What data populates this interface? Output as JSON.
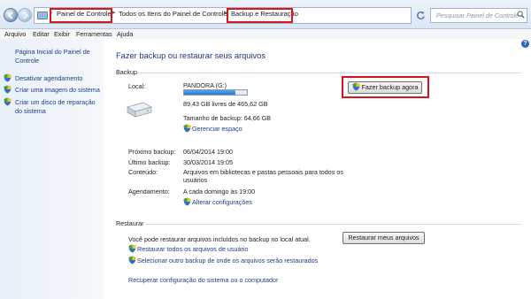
{
  "addressbar": {
    "breadcrumbs": [
      "Painel de Controle",
      "Todos os Itens do Painel de Controle",
      "Backup e Restauração"
    ],
    "search_placeholder": "Pesquisar Painel de Controle"
  },
  "menu": {
    "items": [
      "Arquivo",
      "Editar",
      "Exibir",
      "Ferramentas",
      "Ajuda"
    ]
  },
  "sidebar": {
    "home_link": "Página Inicial do Painel de Controle",
    "tasks": [
      "Desativar agendamento",
      "Criar uma imagem do sistema",
      "Criar um disco de reparação do sistema"
    ]
  },
  "main": {
    "title": "Fazer backup ou restaurar seus arquivos",
    "backup": {
      "heading": "Backup",
      "location_label": "Local:",
      "drive_name": "PANDORA (G:)",
      "drive_usage_fraction": 0.81,
      "free_space": "89,43 GB livres de 465,62 GB",
      "backup_size": "Tamanho de backup: 64,66 GB",
      "manage_space_link": "Gerenciar espaço",
      "backup_now_button": "Fazer backup agora",
      "next_backup_label": "Próximo backup:",
      "next_backup_value": "06/04/2014 19:00",
      "last_backup_label": "Último backup:",
      "last_backup_value": "30/03/2014 19:05",
      "contents_label": "Conteúdo:",
      "contents_value": "Arquivos em bibliotecas e pastas pessoais para todos os usuários",
      "schedule_label": "Agendamento:",
      "schedule_value": "A cada domingo às 19:00",
      "change_settings_link": "Alterar configurações"
    },
    "restore": {
      "heading": "Restaurar",
      "description": "Você pode restaurar arquivos incluídos no backup no local atual.",
      "restore_my_files_button": "Restaurar meus arquivos",
      "restore_all_users_link": "Restaurar todos os arquivos de usuário",
      "select_other_backup_link": "Selecionar outro backup de onde os arquivos serão restaurados",
      "recover_system_link": "Recuperar configuração do sistema ou o computador"
    }
  },
  "colors": {
    "highlight_box": "#d9141b",
    "link": "#1c3d8a",
    "title": "#1e3287"
  }
}
